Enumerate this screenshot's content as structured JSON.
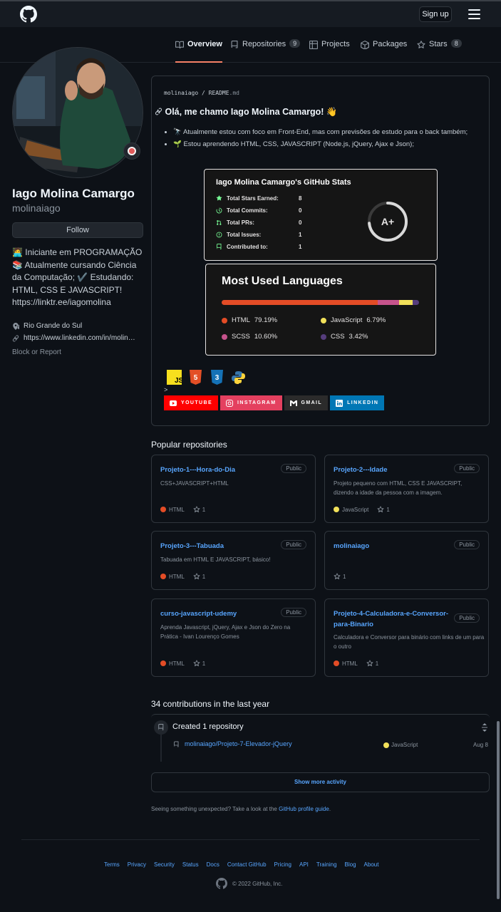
{
  "header": {
    "signup_label": "Sign up"
  },
  "tabs": [
    {
      "label": "Overview",
      "icon": "book-icon"
    },
    {
      "label": "Repositories",
      "count": "9",
      "icon": "repo-icon"
    },
    {
      "label": "Projects",
      "icon": "table-icon"
    },
    {
      "label": "Packages",
      "icon": "package-icon"
    },
    {
      "label": "Stars",
      "count": "8",
      "icon": "star-icon"
    }
  ],
  "profile": {
    "name": "Iago Molina Camargo",
    "login": "molinaiago",
    "follow_label": "Follow",
    "bio_lines": [
      "🧑‍💻 Iniciante em PROGRAMAÇÃO",
      "📚 Atualmente cursando Ciência da Computação; ✔️ Estudando: HTML, CSS E JAVASCRIPT!",
      "https://linktr.ee/iagomolina"
    ],
    "location": "Rio Grande do Sul",
    "website": "https://www.linkedin.com/in/molin…",
    "block_label": "Block or Report"
  },
  "readme": {
    "path_user": "molinaiago",
    "path_sep": " / ",
    "path_file": "README",
    "path_ext": ".md",
    "heading": "Olá, me chamo Iago Molina Camargo! 👋",
    "bullets": [
      "🔭 Atualmente estou com foco em Front-End, mas com previsões de estudo para o back também;",
      "🌱 Estou aprendendo HTML, CSS, JAVASCRIPT (Node.js, jQuery, Ajax e Json);"
    ],
    "stats": {
      "title": "Iago Molina Camargo's GitHub Stats",
      "rows": [
        {
          "label": "Total Stars Earned:",
          "value": "8"
        },
        {
          "label": "Total Commits:",
          "value": "0"
        },
        {
          "label": "Total PRs:",
          "value": "0"
        },
        {
          "label": "Total Issues:",
          "value": "1"
        },
        {
          "label": "Contributed to:",
          "value": "1"
        }
      ],
      "grade": "A+",
      "ring_color": "#d9d9d9"
    },
    "languages": {
      "title": "Most Used Languages",
      "items": [
        {
          "name": "HTML",
          "percent": "79.19%",
          "value": 79.19,
          "color": "#e34c26"
        },
        {
          "name": "JavaScript",
          "percent": "6.79%",
          "value": 6.79,
          "color": "#f1e05a"
        },
        {
          "name": "SCSS",
          "percent": "10.60%",
          "value": 10.6,
          "color": "#c6538c"
        },
        {
          "name": "CSS",
          "percent": "3.42%",
          "value": 3.42,
          "color": "#563d7c"
        }
      ]
    },
    "gt": ">",
    "badges": [
      {
        "label": "YOUTUBE",
        "color": "#ff0000"
      },
      {
        "label": "INSTAGRAM",
        "color": "#e4405f"
      },
      {
        "label": "GMAIL",
        "color": "#2b2b2b"
      },
      {
        "label": "LINKEDIN",
        "color": "#0077b5"
      }
    ]
  },
  "popular": {
    "title": "Popular repositories",
    "repos": [
      {
        "name": "Projeto-1---Hora-do-Dia",
        "visibility": "Public",
        "desc": "CSS+JAVASCRIPT+HTML",
        "lang": "HTML",
        "lang_color": "#e34c26",
        "stars": "1"
      },
      {
        "name": "Projeto-2---Idade",
        "visibility": "Public",
        "desc": "Projeto pequeno com HTML, CSS E JAVASCRIPT, dizendo a idade da pessoa com a imagem.",
        "lang": "JavaScript",
        "lang_color": "#f1e05a",
        "stars": "1"
      },
      {
        "name": "Projeto-3---Tabuada",
        "visibility": "Public",
        "desc": "Tabuada em HTML E JAVASCRIPT, básico!",
        "lang": "HTML",
        "lang_color": "#e34c26",
        "stars": "1"
      },
      {
        "name": "molinaiago",
        "visibility": "Public",
        "desc": "",
        "lang": "",
        "lang_color": "",
        "stars": "1"
      },
      {
        "name": "curso-javascript-udemy",
        "visibility": "Public",
        "desc": "Aprenda Javascript, jQuery, Ajax e Json do Zero na Prática - Ivan Lourenço Gomes",
        "lang": "HTML",
        "lang_color": "#e34c26",
        "stars": "1"
      },
      {
        "name": "Projeto-4-Calculadora-e-Conversor-para-Binario",
        "visibility": "Public",
        "desc": "Calculadora e Conversor para binário com links de um para o outro",
        "lang": "HTML",
        "lang_color": "#e34c26",
        "stars": "1"
      }
    ]
  },
  "contributions": {
    "title": "34 contributions in the last year",
    "event_title": "Created 1 repository",
    "repo": "molinaiago/Projeto-7-Elevador-jQuery",
    "lang": "JavaScript",
    "lang_color": "#f1e05a",
    "date": "Aug 8",
    "show_more": "Show more activity",
    "unexpected_text": "Seeing something unexpected? Take a look at the ",
    "unexpected_link": "GitHub profile guide",
    "unexpected_end": "."
  },
  "footer": {
    "links": [
      "Terms",
      "Privacy",
      "Security",
      "Status",
      "Docs",
      "Contact GitHub",
      "Pricing",
      "API",
      "Training",
      "Blog",
      "About"
    ],
    "copyright": "© 2022 GitHub, Inc."
  }
}
